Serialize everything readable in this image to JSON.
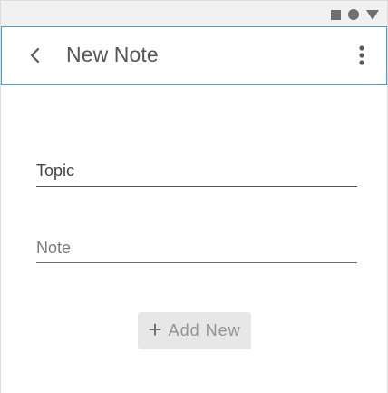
{
  "status_bar": {
    "icons": [
      "square-icon",
      "circle-icon",
      "triangle-icon"
    ]
  },
  "app_bar": {
    "title": "New Note",
    "back_icon": "chevron-left-icon",
    "menu_icon": "more-vertical-icon",
    "focus_color": "#4a9fdd"
  },
  "form": {
    "topic": {
      "value": "Topic",
      "placeholder": ""
    },
    "note": {
      "value": "",
      "placeholder": "Note"
    },
    "add_button": {
      "icon": "plus-icon",
      "icon_glyph": "+",
      "label": "Add New"
    }
  }
}
